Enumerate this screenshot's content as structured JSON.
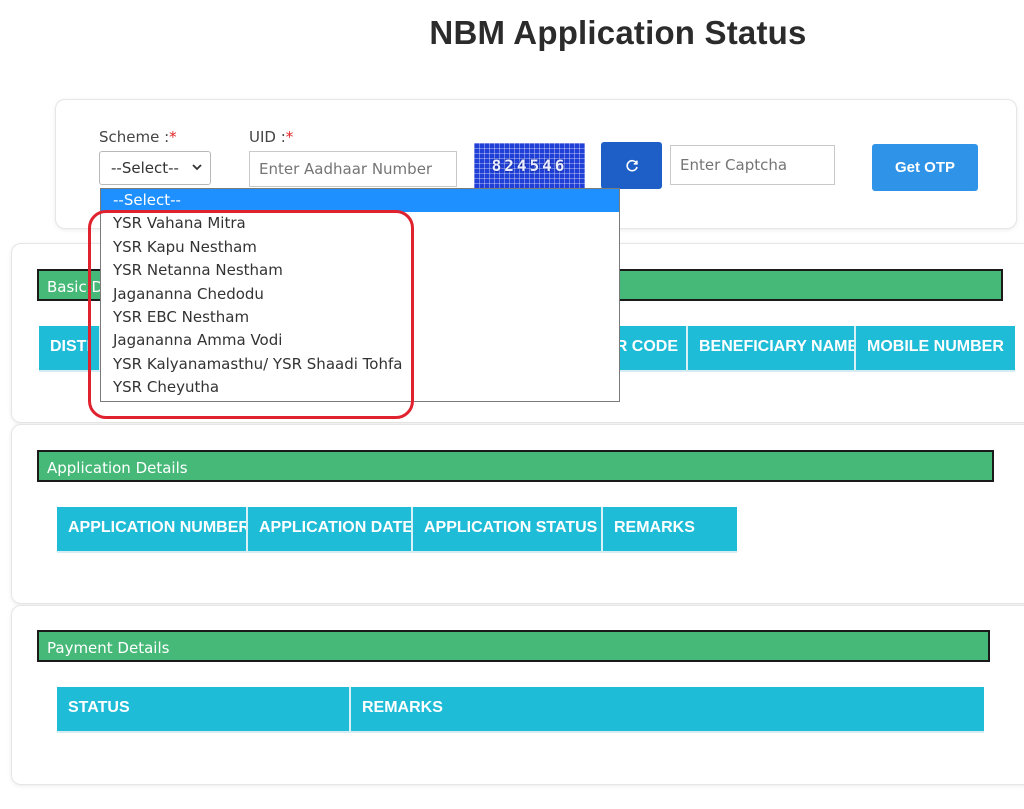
{
  "page": {
    "title": "NBM Application Status"
  },
  "search": {
    "scheme_label": "Scheme :",
    "uid_label": "UID :",
    "required_mark": "*",
    "scheme_selected": "--Select--",
    "uid_placeholder": "Enter Aadhaar Number",
    "captcha_text": "824546",
    "captcha_placeholder": "Enter Captcha",
    "refresh_icon": "refresh-icon",
    "get_otp_label": "Get OTP"
  },
  "scheme_dropdown": {
    "options": [
      "--Select--",
      "YSR Vahana Mitra",
      "YSR Kapu Nestham",
      "YSR Netanna Nestham",
      "Jagananna Chedodu",
      "YSR EBC Nestham",
      "Jagananna Amma Vodi",
      "YSR Kalyanamasthu/ YSR Shaadi Tohfa",
      "YSR Cheyutha"
    ],
    "selected_index": 0,
    "highlight_color": "#e0212e"
  },
  "basic_details": {
    "header": "Basic D",
    "columns": [
      "DISTI",
      "ER CODE",
      "BENEFICIARY NAME",
      "MOBILE NUMBER"
    ]
  },
  "application_details": {
    "header": "Application Details",
    "columns": [
      "APPLICATION NUMBER",
      "APPLICATION DATE",
      "APPLICATION STATUS",
      "REMARKS"
    ]
  },
  "payment_details": {
    "header": "Payment Details",
    "columns": [
      "STATUS",
      "REMARKS"
    ]
  },
  "colors": {
    "section_header": "#46b978",
    "table_header": "#1fbcd8",
    "otp_button": "#2f93e8",
    "refresh_button": "#1d5fc7"
  }
}
